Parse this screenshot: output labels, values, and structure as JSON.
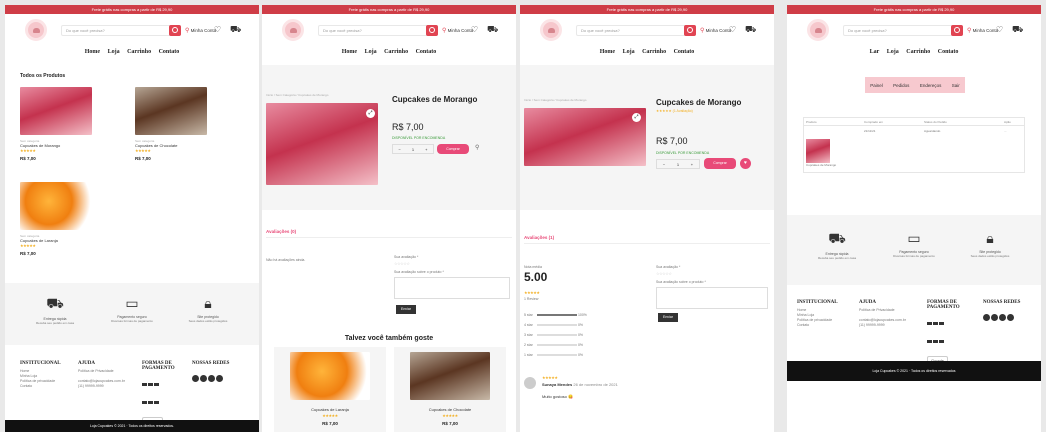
{
  "common": {
    "topbar": "Frete grátis nas compras a partir de R$ 29,90",
    "search_placeholder": "Do que você precisa?",
    "account": "Minha Conta",
    "nav": [
      "Home",
      "Loja",
      "Carrinho",
      "Contato"
    ]
  },
  "panel1": {
    "section_title": "Todos os Produtos",
    "products": [
      {
        "cat": "Sem categoria",
        "name": "Cupcakes de Morango",
        "stars": "★★★★★",
        "price": "R$ 7,00"
      },
      {
        "cat": "Sem categoria",
        "name": "Cupcakes de Chocolate",
        "stars": "★★★★★",
        "price": "R$ 7,00"
      },
      {
        "cat": "Sem categoria",
        "name": "Cupcakes de Laranja",
        "stars": "★★★★★",
        "price": "R$ 7,00"
      }
    ],
    "copyright": "Loja Cupcakes © 2021 · Todos os direitos reservados."
  },
  "features": [
    {
      "title": "Entrega rápida",
      "text": "Receba seu pedido em casa"
    },
    {
      "title": "Pagamento seguro",
      "text": "Diversas formas de pagamento"
    },
    {
      "title": "Site protegido",
      "text": "Seus dados estão protegidos"
    }
  ],
  "footer": {
    "institucional": "INSTITUCIONAL",
    "inst_links": [
      "Home",
      "Minha Loja",
      "Política de privacidade",
      "Contato"
    ],
    "ajuda": "AJUDA",
    "ajuda_text": "Política de Privacidade",
    "email": "contato@lojacupcakes.com.br",
    "phone": "(11) 99999-9999",
    "formas": "FORMAS DE PAGAMENTO",
    "redes": "NOSSAS REDES",
    "google": "Google"
  },
  "product_page": {
    "breadcrumb": "Início / Sem Categoria / Cupcakes de Morango",
    "title": "Cupcakes de Morango",
    "price": "R$ 7,00",
    "stock": "DISPONÍVEL POR ENCOMENDA",
    "qty": "1",
    "buy": "Comprar",
    "reviews_tab": "Avaliações (0)",
    "no_reviews": "Não há avaliações ainda.",
    "your_rating": "Sua avaliação *",
    "your_review": "Sua avaliação sobre o produto *",
    "send": "Enviar",
    "related_title": "Talvez você também goste",
    "related": [
      {
        "name": "Cupcakes de Laranja",
        "stars": "★★★★★",
        "price": "R$ 7,00"
      },
      {
        "name": "Cupcakes de Chocolate",
        "stars": "★★★★★",
        "price": "R$ 7,00"
      }
    ]
  },
  "product_page2": {
    "breadcrumb": "Início / Sem Categoria / Cupcakes de Morango",
    "title": "Cupcakes de Morango",
    "rating_small": "★★★★★ (1 Avaliação)",
    "price": "R$ 7,00",
    "stock": "DISPONÍVEL POR ENCOMENDA",
    "qty": "1",
    "buy": "Comprar",
    "reviews_tab": "Avaliações (1)",
    "avg_label": "Nota média",
    "avg": "5.00",
    "stars": "★★★★★",
    "count": "1 Review",
    "dist": [
      {
        "label": "5 star",
        "pct": "100%"
      },
      {
        "label": "4 star",
        "pct": "0%"
      },
      {
        "label": "3 star",
        "pct": "0%"
      },
      {
        "label": "2 star",
        "pct": "0%"
      },
      {
        "label": "1 star",
        "pct": "0%"
      }
    ],
    "review_author": "Sunaya Mendes",
    "review_date": "26 de novembro de 2021",
    "review_text": "Muito gostoso 😋",
    "your_rating": "Sua avaliação *",
    "your_review": "Sua avaliação sobre o produto *",
    "send": "Enviar"
  },
  "account_page": {
    "nav": [
      "Lar",
      "Loja",
      "Carrinho",
      "Contato"
    ],
    "tabs": [
      "Painel",
      "Pedidos",
      "Endereços",
      "Sair"
    ],
    "cols": [
      "Produto",
      "Comprado em",
      "Status do Pedido",
      "Ação"
    ],
    "row": {
      "product": "Cupcakes de Morango",
      "date": "21/11/21",
      "status": "Aguardando",
      "action": "..."
    },
    "copyright": "Loja Cupcakes © 2021 · Todos os direitos reservados"
  }
}
